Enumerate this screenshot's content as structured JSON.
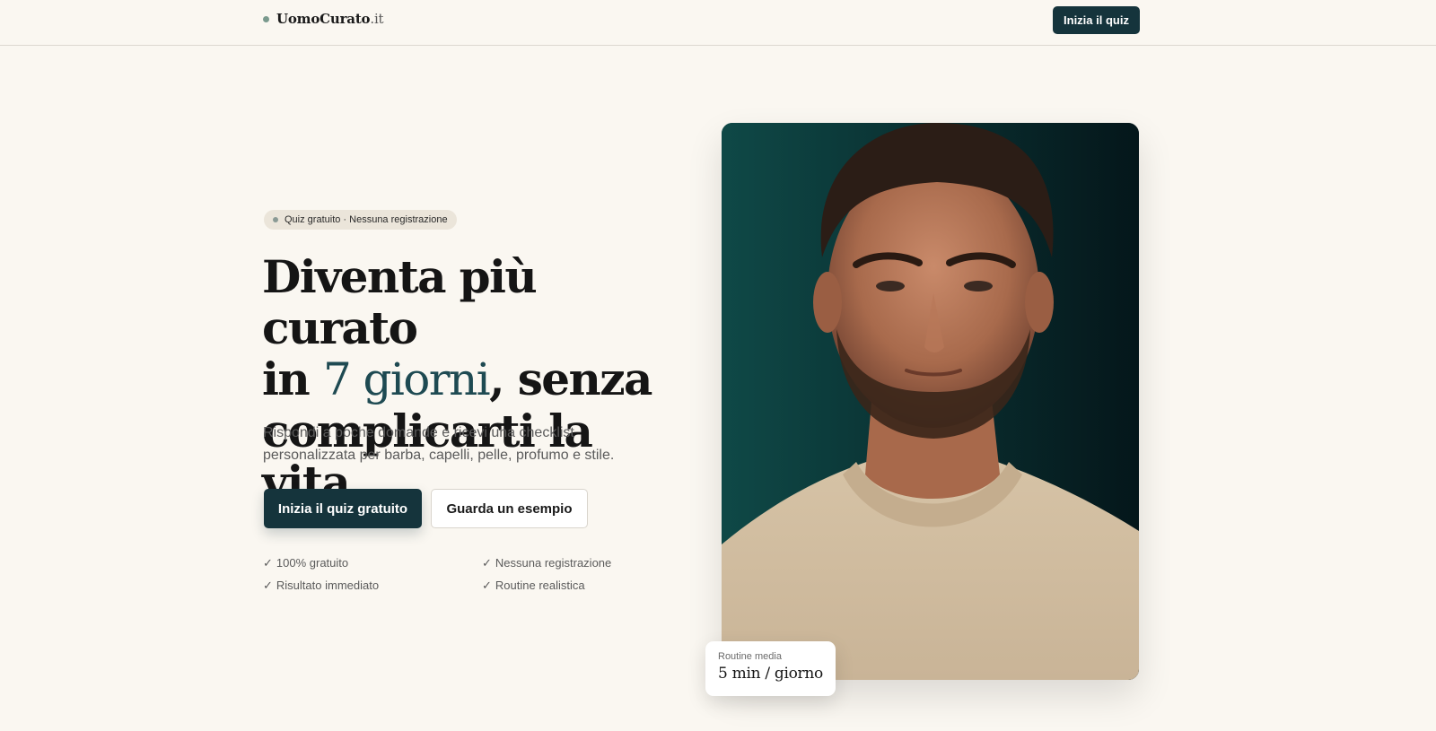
{
  "nav": {
    "brand_name": "UomoCurato",
    "brand_tld": ".it",
    "cta_label": "Inizia il quiz"
  },
  "hero": {
    "pill_text": "Quiz gratuito · Nessuna registrazione",
    "headline": {
      "line1": "Diventa più curato",
      "line2_before": "in ",
      "line2_accent": "7 giorni",
      "line2_after": ", senza",
      "line3": "complicarti la vita."
    },
    "subtext": "Rispondi a poche domande e ricevi una checklist personalizzata per barba, capelli, pelle, profumo e stile.",
    "primary_cta": "Inizia il quiz gratuito",
    "secondary_cta": "Guarda un esempio",
    "features": [
      {
        "check": "✓",
        "label": "100% gratuito"
      },
      {
        "check": "✓",
        "label": "Nessuna registrazione"
      },
      {
        "check": "✓",
        "label": "Risultato immediato"
      },
      {
        "check": "✓",
        "label": "Routine realistica"
      }
    ]
  },
  "stat_card": {
    "label": "Routine media",
    "value": "5 min / giorno"
  },
  "colors": {
    "background": "#faf7f1",
    "primary": "#15343c",
    "accent_text": "#1e4a52",
    "pill_bg": "#ebe5da"
  },
  "icons": {
    "brand_dot": "dot-icon",
    "pill_dot": "dot-icon",
    "feature_check": "check-icon"
  }
}
